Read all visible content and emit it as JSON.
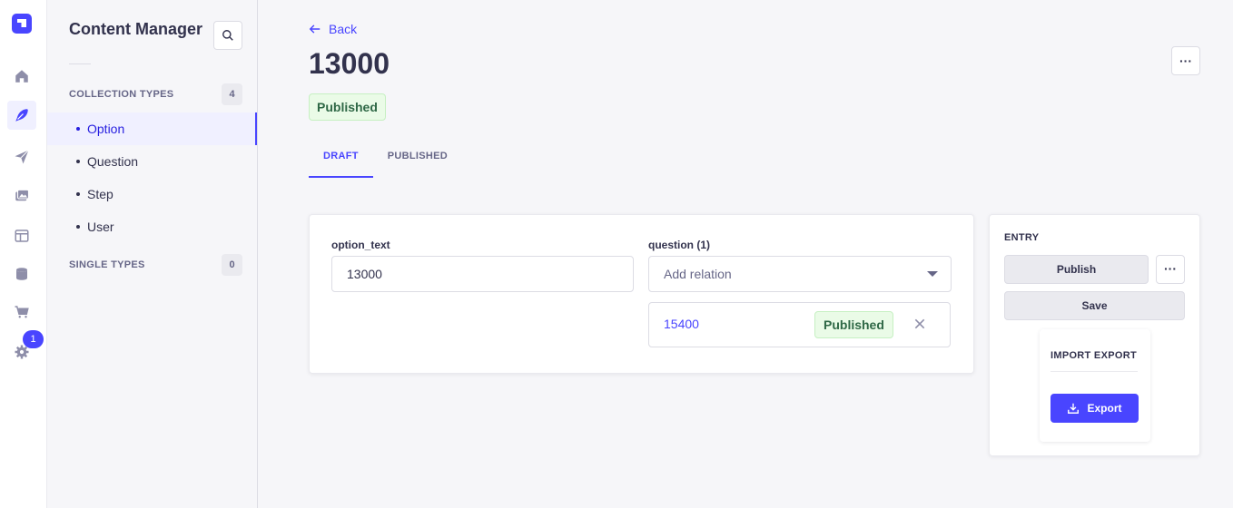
{
  "rail": {
    "notification_count": "1"
  },
  "subnav": {
    "title": "Content Manager",
    "collection_types": {
      "label": "COLLECTION TYPES",
      "count": "4",
      "items": [
        "Option",
        "Question",
        "Step",
        "User"
      ],
      "active": "Option"
    },
    "single_types": {
      "label": "SINGLE TYPES",
      "count": "0"
    }
  },
  "header": {
    "back_label": "Back",
    "title": "13000",
    "status": "Published",
    "more_label": "···"
  },
  "tabs": [
    {
      "label": "DRAFT",
      "active": true
    },
    {
      "label": "PUBLISHED",
      "active": false
    }
  ],
  "form": {
    "option_text": {
      "label": "option_text",
      "value": "13000"
    },
    "question": {
      "label": "question (1)",
      "placeholder": "Add relation",
      "relation": {
        "link": "15400",
        "status": "Published"
      }
    }
  },
  "entry_panel": {
    "title": "ENTRY",
    "publish_label": "Publish",
    "more_label": "···",
    "save_label": "Save",
    "plugin_title": "IMPORT EXPORT",
    "export_label": "Export"
  },
  "colors": {
    "primary": "#4945ff",
    "success_bg": "#eafbe7",
    "success_text": "#2f6846",
    "neutral_bg": "#f6f6f9"
  }
}
